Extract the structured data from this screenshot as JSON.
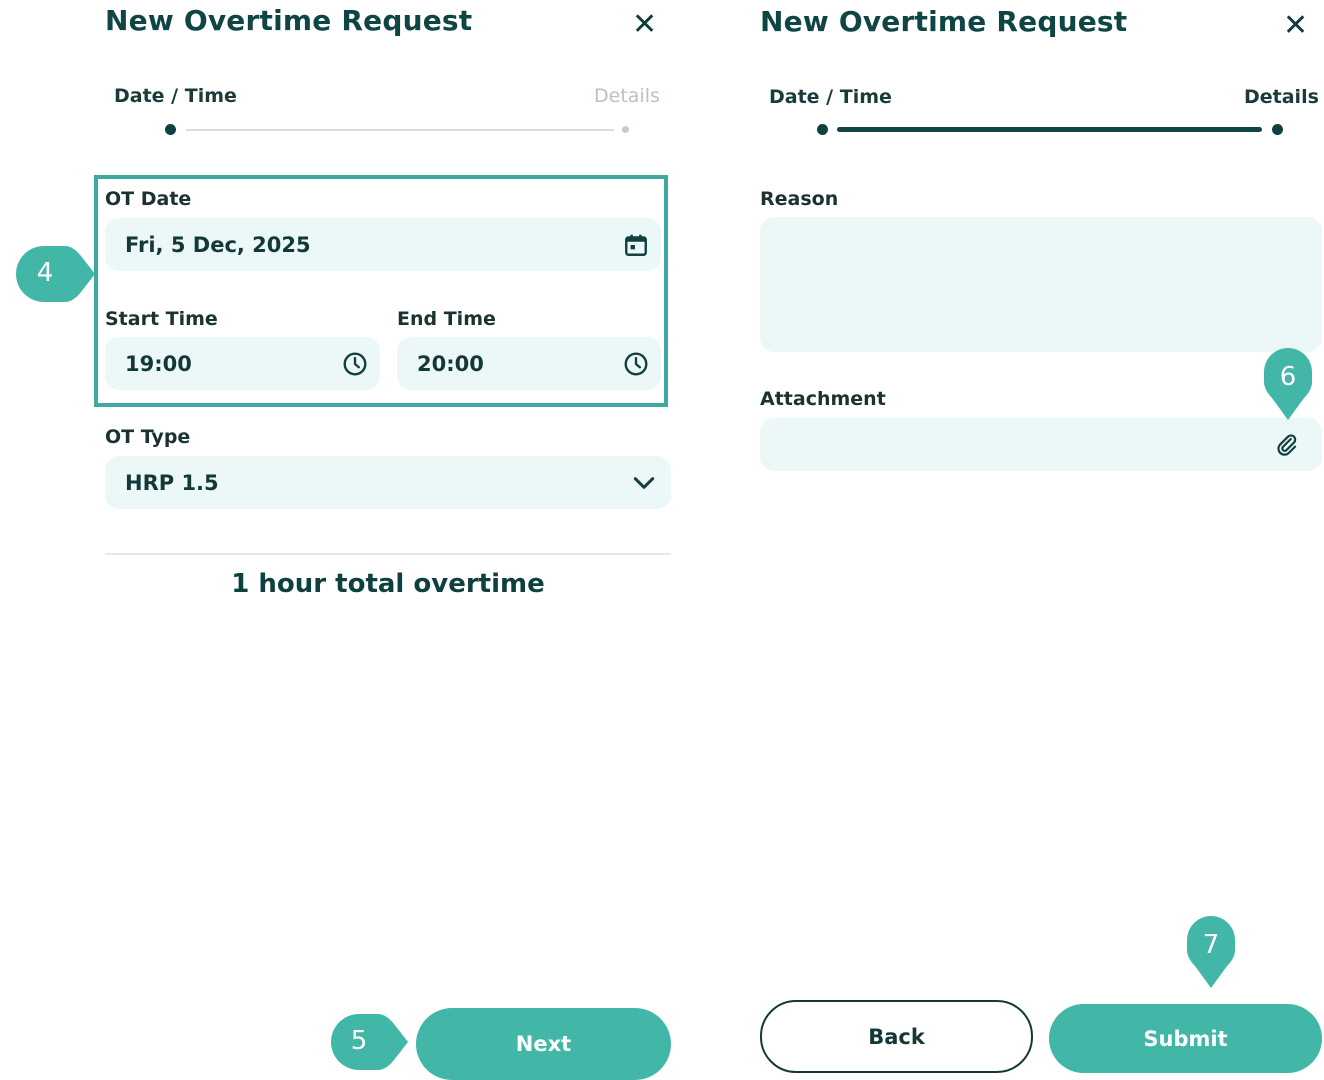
{
  "left_panel": {
    "title": "New Overtime Request",
    "close_glyph": "✕",
    "steps": [
      {
        "label": "Date / Time",
        "state": "active"
      },
      {
        "label": "Details",
        "state": "inactive"
      }
    ],
    "progress": 0,
    "ot_date": {
      "label": "OT Date",
      "value": "Fri, 5 Dec, 2025",
      "icon": "calendar-icon"
    },
    "start_time": {
      "label": "Start Time",
      "value": "19:00",
      "icon": "clock-icon"
    },
    "end_time": {
      "label": "End Time",
      "value": "20:00",
      "icon": "clock-icon"
    },
    "ot_type": {
      "label": "OT Type",
      "value": "HRP 1.5",
      "icon": "chevron-down-icon"
    },
    "total_text": "1 hour total overtime",
    "next_label": "Next"
  },
  "right_panel": {
    "title": "New Overtime Request",
    "close_glyph": "✕",
    "steps": [
      {
        "label": "Date / Time",
        "state": "done"
      },
      {
        "label": "Details",
        "state": "active"
      }
    ],
    "progress": 1,
    "reason": {
      "label": "Reason",
      "value": ""
    },
    "attachment": {
      "label": "Attachment",
      "value": "",
      "icon": "paperclip-icon"
    },
    "back_label": "Back",
    "submit_label": "Submit"
  },
  "callouts": [
    "4",
    "5",
    "6",
    "7"
  ],
  "colors": {
    "accent": "#42b7a7",
    "highlight_border": "#3fa8a0",
    "field_bg": "#ecf8f8",
    "text_dark": "#0f4545",
    "progress_active": "#0f4545",
    "progress_inactive": "#d8dede"
  }
}
